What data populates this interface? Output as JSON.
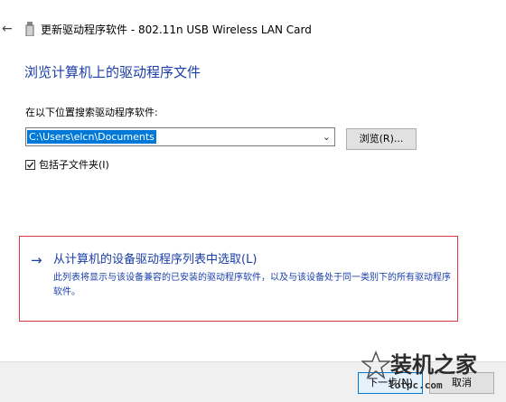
{
  "window": {
    "back_icon": "back-arrow-icon",
    "device_icon": "device-icon",
    "title": "更新驱动程序软件 - 802.11n USB Wireless LAN Card"
  },
  "main": {
    "heading": "浏览计算机上的驱动程序文件",
    "search_label": "在以下位置搜索驱动程序软件:",
    "path_value": "C:\\Users\\elcn\\Documents",
    "browse_label": "浏览(R)...",
    "include_subfolders_label": "包括子文件夹(I)",
    "include_subfolders_checked": true
  },
  "pick_option": {
    "arrow_icon": "arrow-right-icon",
    "title": "从计算机的设备驱动程序列表中选取(L)",
    "description": "此列表将显示与该设备兼容的已安装的驱动程序软件，以及与该设备处于同一类别下的所有驱动程序软件。"
  },
  "footer": {
    "next_label": "下一步(N)",
    "cancel_label": "取消"
  },
  "watermark": {
    "title": "装机之家",
    "url": "lotpc.com"
  },
  "colors": {
    "link_blue": "#1a3ea8",
    "highlight_box": "#d9383e",
    "selection_blue": "#0078d7"
  }
}
